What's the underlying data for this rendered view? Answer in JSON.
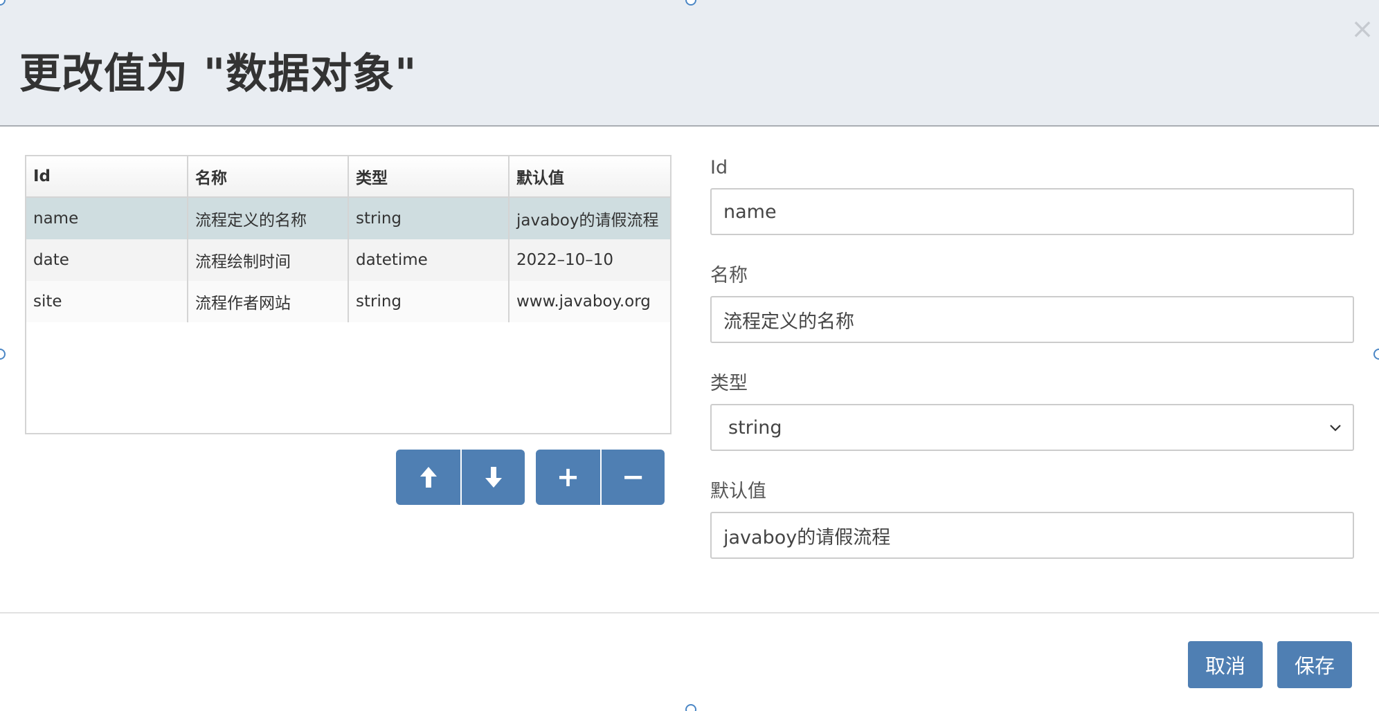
{
  "dialog": {
    "title": "更改值为 \"数据对象\"",
    "close_label": "×"
  },
  "table": {
    "columns": [
      "Id",
      "名称",
      "类型",
      "默认值"
    ],
    "rows": [
      [
        "name",
        "流程定义的名称",
        "string",
        "javaboy的请假流程"
      ],
      [
        "date",
        "流程绘制时间",
        "datetime",
        "2022–10–10"
      ],
      [
        "site",
        "流程作者网站",
        "string",
        "www.javaboy.org"
      ]
    ],
    "selected_row": 0
  },
  "toolbar": {
    "move_up_icon": "arrow-up-icon",
    "move_down_icon": "arrow-down-icon",
    "add_label": "+",
    "remove_label": "−"
  },
  "form": {
    "id_label": "Id",
    "id_value": "name",
    "name_label": "名称",
    "name_value": "流程定义的名称",
    "type_label": "类型",
    "type_value": "string",
    "default_label": "默认值",
    "default_value": "javaboy的请假流程"
  },
  "footer": {
    "cancel_label": "取消",
    "save_label": "保存"
  },
  "colors": {
    "header_bg": "#e9edf2",
    "primary": "#4f7fb3",
    "selected_row": "#cfdde0"
  }
}
